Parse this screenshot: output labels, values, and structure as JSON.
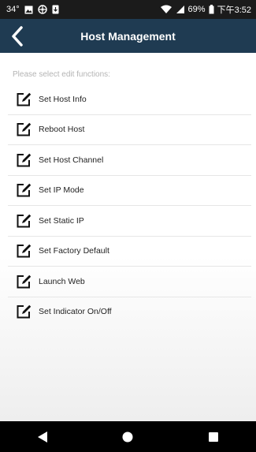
{
  "status_bar": {
    "temperature": "34°",
    "battery_percent": "69%",
    "time": "下午3:52"
  },
  "header": {
    "title": "Host Management",
    "back_icon": "chevron-left-icon"
  },
  "main": {
    "prompt": "Please select edit functions:",
    "items": [
      {
        "label": "Set Host Info",
        "icon": "edit-icon"
      },
      {
        "label": "Reboot Host",
        "icon": "edit-icon"
      },
      {
        "label": "Set Host Channel",
        "icon": "edit-icon"
      },
      {
        "label": "Set IP Mode",
        "icon": "edit-icon"
      },
      {
        "label": "Set Static IP",
        "icon": "edit-icon"
      },
      {
        "label": "Set Factory Default",
        "icon": "edit-icon"
      },
      {
        "label": "Launch Web",
        "icon": "edit-icon"
      },
      {
        "label": "Set Indicator On/Off",
        "icon": "edit-icon"
      }
    ]
  },
  "nav_bar": {
    "back": "back-triangle-icon",
    "home": "home-circle-icon",
    "recents": "recents-square-icon"
  },
  "colors": {
    "status_bar": "#1b1b1b",
    "title_bar": "#1f3b52",
    "nav_bar": "#000000",
    "prompt_text": "#b4b4b4"
  }
}
